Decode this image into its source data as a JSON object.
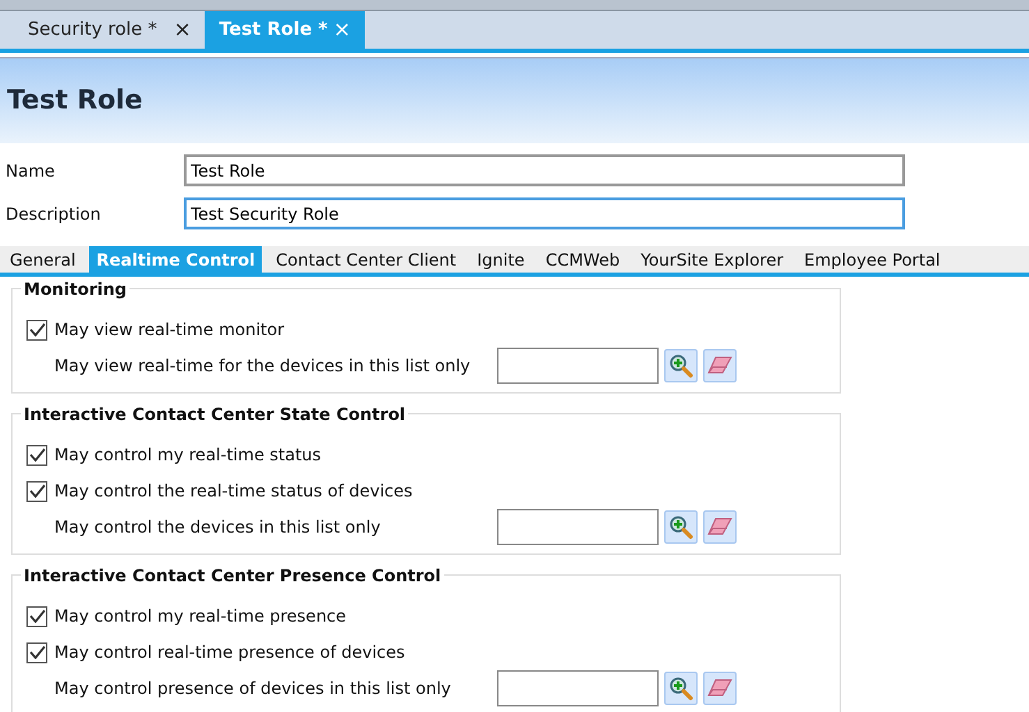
{
  "doc_tabs": [
    {
      "label": "Security role *",
      "close": "×",
      "selected": false
    },
    {
      "label": "Test Role *",
      "close": "×",
      "selected": true
    }
  ],
  "title": "Test Role",
  "fields": [
    {
      "label": "Name",
      "value": "Test Role",
      "focused": false
    },
    {
      "label": "Description",
      "value": "Test Security Role",
      "focused": true
    }
  ],
  "tabs": [
    {
      "label": "General",
      "selected": false
    },
    {
      "label": "Realtime Control",
      "selected": true
    },
    {
      "label": "Contact Center Client",
      "selected": false
    },
    {
      "label": "Ignite",
      "selected": false
    },
    {
      "label": "CCMWeb",
      "selected": false
    },
    {
      "label": "YourSite Explorer",
      "selected": false
    },
    {
      "label": "Employee Portal",
      "selected": false
    }
  ],
  "groups": [
    {
      "title": "Monitoring",
      "rows": [
        {
          "kind": "checkbox",
          "label": "May view real-time monitor",
          "checked": true
        },
        {
          "kind": "list",
          "label": "May view real-time for the devices in this list only"
        }
      ]
    },
    {
      "title": "Interactive Contact Center State Control",
      "rows": [
        {
          "kind": "checkbox",
          "label": "May control my real-time status",
          "checked": true
        },
        {
          "kind": "checkbox",
          "label": "May control the real-time status of devices",
          "checked": true
        },
        {
          "kind": "list",
          "label": "May control the devices in this list only"
        }
      ]
    },
    {
      "title": "Interactive Contact Center Presence Control",
      "rows": [
        {
          "kind": "checkbox",
          "label": "May control my real-time presence",
          "checked": true
        },
        {
          "kind": "checkbox",
          "label": "May control real-time presence of devices",
          "checked": true
        },
        {
          "kind": "list",
          "label": "May control presence of devices in this list only"
        }
      ]
    }
  ]
}
